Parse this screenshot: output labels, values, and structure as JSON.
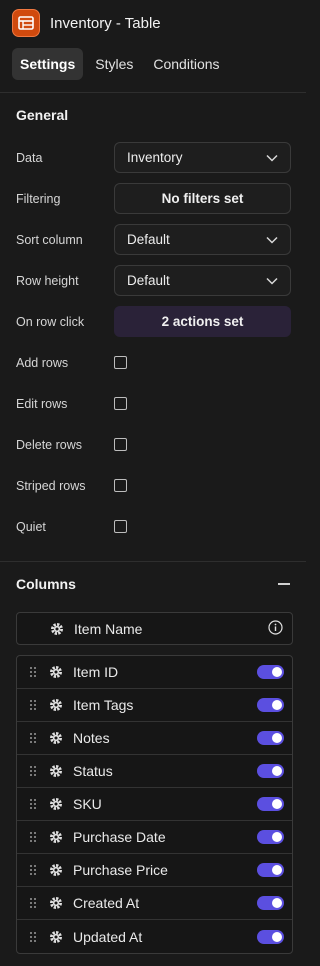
{
  "header": {
    "title": "Inventory - Table",
    "icon": "table-icon",
    "icon_color": "#d04a0e"
  },
  "tabs": [
    {
      "label": "Settings",
      "active": true
    },
    {
      "label": "Styles",
      "active": false
    },
    {
      "label": "Conditions",
      "active": false
    }
  ],
  "general": {
    "title": "General",
    "data_label": "Data",
    "data_value": "Inventory",
    "filtering_label": "Filtering",
    "filtering_value": "No filters set",
    "sort_label": "Sort column",
    "sort_value": "Default",
    "row_height_label": "Row height",
    "row_height_value": "Default",
    "row_click_label": "On row click",
    "row_click_value": "2 actions set",
    "checkboxes": [
      {
        "label": "Add rows",
        "checked": false
      },
      {
        "label": "Edit rows",
        "checked": false
      },
      {
        "label": "Delete rows",
        "checked": false
      },
      {
        "label": "Striped rows",
        "checked": false
      },
      {
        "label": "Quiet",
        "checked": false
      }
    ]
  },
  "columns": {
    "title": "Columns",
    "name_column": "Item Name",
    "items": [
      {
        "label": "Item ID",
        "enabled": true
      },
      {
        "label": "Item Tags",
        "enabled": true
      },
      {
        "label": "Notes",
        "enabled": true
      },
      {
        "label": "Status",
        "enabled": true
      },
      {
        "label": "SKU",
        "enabled": true
      },
      {
        "label": "Purchase Date",
        "enabled": true
      },
      {
        "label": "Purchase Price",
        "enabled": true
      },
      {
        "label": "Created At",
        "enabled": true
      },
      {
        "label": "Updated At",
        "enabled": true
      }
    ],
    "toggle_color": "#5b4fe0"
  }
}
